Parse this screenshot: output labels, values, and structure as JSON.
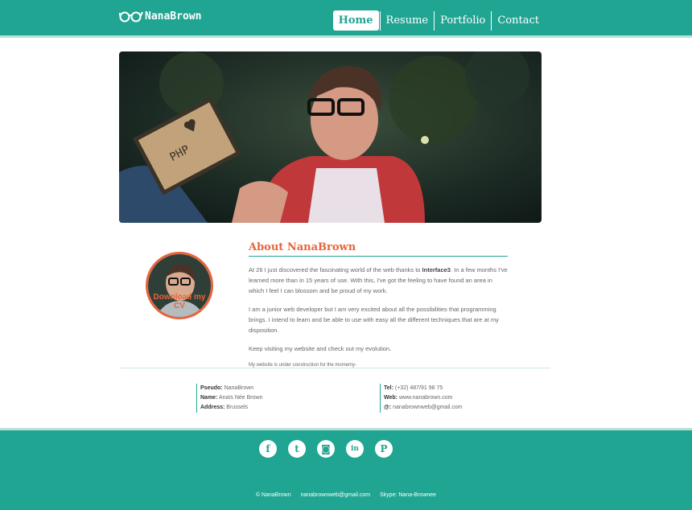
{
  "header": {
    "logo_text": "NanaBrown",
    "nav": [
      {
        "label": "Home",
        "active": true
      },
      {
        "label": "Resume",
        "active": false
      },
      {
        "label": "Portfolio",
        "active": false
      },
      {
        "label": "Contact",
        "active": false
      }
    ]
  },
  "hero": {
    "sign_text": "PHP"
  },
  "about": {
    "title": "About NanaBrown",
    "avatar_label": "Download my CV",
    "p1_before": "At 26 I just discovered the fascinating world of the web thanks to ",
    "p1_bold": "Interface3",
    "p1_after": ". In a few months I've learned more than in 15 years of use. With this, I've got the feeling to have found an area in which I feel I can blossom and be proud of my work.",
    "p2": "I am a junior web developer but I am very excited about all the possibilities that programming brings. I intend to learn and be able to use with easy all the different techniques that are at my disposition.",
    "p3": "Keep visiting my website and check out my evolution.",
    "note": "My website is under construction for the momemy-"
  },
  "info_left": [
    {
      "label": "Pseudo:",
      "value": "NanaBrown"
    },
    {
      "label": "Name:",
      "value": "Anaïs Née Brown"
    },
    {
      "label": "Address:",
      "value": "Brussels"
    }
  ],
  "info_right": [
    {
      "label": "Tel:",
      "value": "(+32) 487/91 98 75"
    },
    {
      "label": "Web:",
      "value": "www.nanabrown.com"
    },
    {
      "label": "@:",
      "value": "nanabrownweb@gmail.com"
    }
  ],
  "footer": {
    "socials": [
      {
        "icon": "facebook-icon",
        "glyph": "f"
      },
      {
        "icon": "twitter-icon",
        "glyph": "t"
      },
      {
        "icon": "instagram-icon",
        "glyph": "◙"
      },
      {
        "icon": "linkedin-icon",
        "glyph": "in"
      },
      {
        "icon": "pinterest-icon",
        "glyph": "P"
      }
    ],
    "copyright": "© NanaBrown",
    "email": "nanabrownweb@gmail.com",
    "skype": "Skype: Nana-Brownee"
  },
  "colors": {
    "primary": "#21a593",
    "accent": "#e8643a"
  }
}
